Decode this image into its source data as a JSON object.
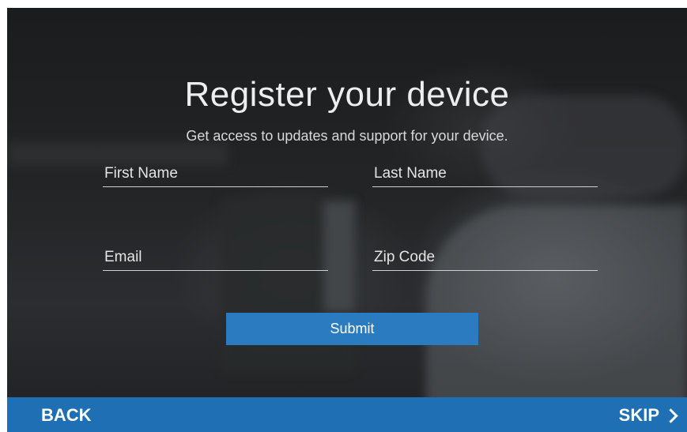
{
  "header": {
    "title": "Register your device",
    "subtitle": "Get access to updates and support for your device."
  },
  "form": {
    "first_name": {
      "placeholder": "First Name",
      "value": ""
    },
    "last_name": {
      "placeholder": "Last Name",
      "value": ""
    },
    "email": {
      "placeholder": "Email",
      "value": ""
    },
    "zip_code": {
      "placeholder": "Zip Code",
      "value": ""
    },
    "submit_label": "Submit"
  },
  "footer": {
    "back_label": "BACK",
    "skip_label": "SKIP",
    "skip_icon": "chevron-right-icon"
  },
  "colors": {
    "accent": "#2b7bc0",
    "footer_bar": "#1f6fb5",
    "background": "#1d1f21"
  }
}
